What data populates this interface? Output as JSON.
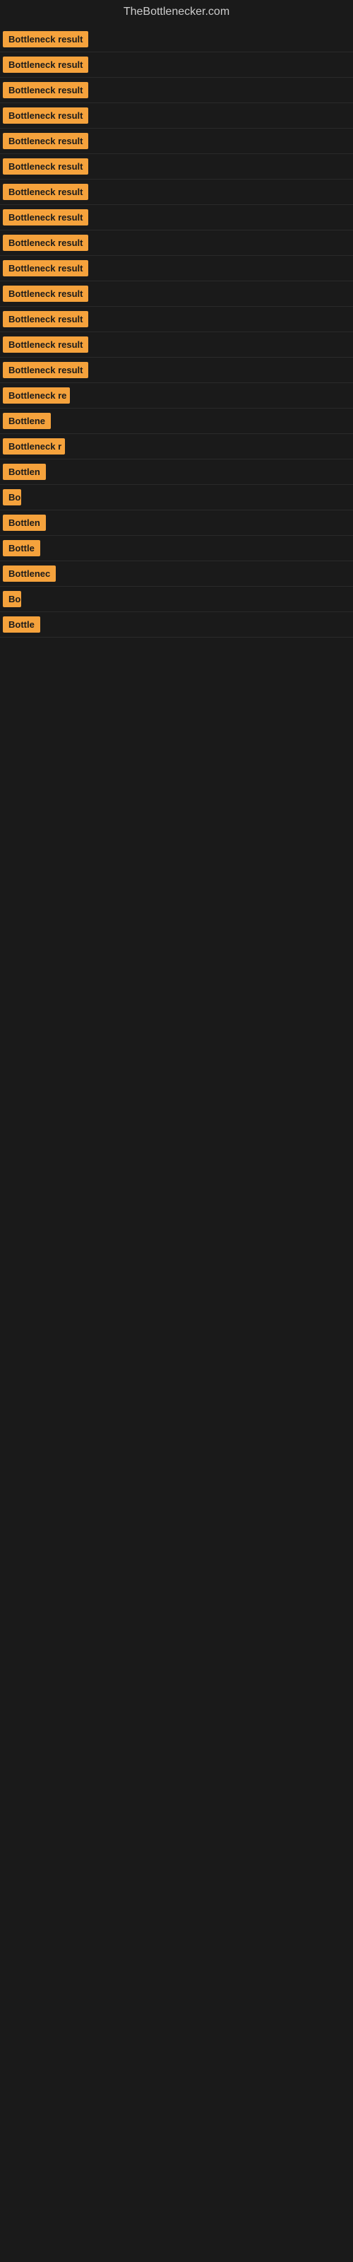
{
  "site": {
    "title": "TheBottlenecker.com"
  },
  "results": [
    {
      "id": 1,
      "label": "Bottleneck result",
      "width": 130
    },
    {
      "id": 2,
      "label": "Bottleneck result",
      "width": 130
    },
    {
      "id": 3,
      "label": "Bottleneck result",
      "width": 130
    },
    {
      "id": 4,
      "label": "Bottleneck result",
      "width": 130
    },
    {
      "id": 5,
      "label": "Bottleneck result",
      "width": 130
    },
    {
      "id": 6,
      "label": "Bottleneck result",
      "width": 130
    },
    {
      "id": 7,
      "label": "Bottleneck result",
      "width": 130
    },
    {
      "id": 8,
      "label": "Bottleneck result",
      "width": 130
    },
    {
      "id": 9,
      "label": "Bottleneck result",
      "width": 130
    },
    {
      "id": 10,
      "label": "Bottleneck result",
      "width": 130
    },
    {
      "id": 11,
      "label": "Bottleneck result",
      "width": 130
    },
    {
      "id": 12,
      "label": "Bottleneck result",
      "width": 130
    },
    {
      "id": 13,
      "label": "Bottleneck result",
      "width": 130
    },
    {
      "id": 14,
      "label": "Bottleneck result",
      "width": 130
    },
    {
      "id": 15,
      "label": "Bottleneck re",
      "width": 95
    },
    {
      "id": 16,
      "label": "Bottlene",
      "width": 72
    },
    {
      "id": 17,
      "label": "Bottleneck r",
      "width": 88
    },
    {
      "id": 18,
      "label": "Bottlen",
      "width": 64
    },
    {
      "id": 19,
      "label": "Bo",
      "width": 26
    },
    {
      "id": 20,
      "label": "Bottlen",
      "width": 64
    },
    {
      "id": 21,
      "label": "Bottle",
      "width": 54
    },
    {
      "id": 22,
      "label": "Bottlenec",
      "width": 76
    },
    {
      "id": 23,
      "label": "Bo",
      "width": 26
    },
    {
      "id": 24,
      "label": "Bottle",
      "width": 54
    }
  ]
}
